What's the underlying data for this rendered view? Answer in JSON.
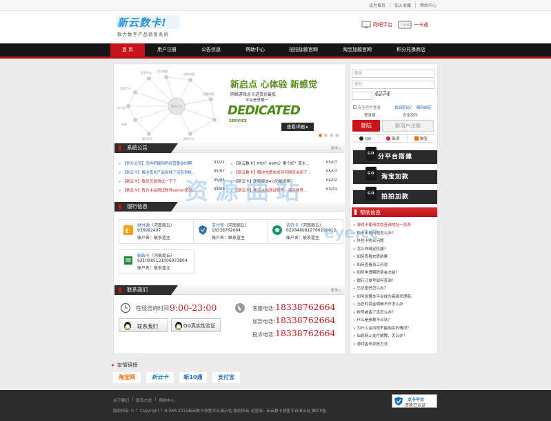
{
  "top_links": [
    "设为首页",
    "加入收藏",
    "帮助中心"
  ],
  "logo": {
    "main": "新云数卡!",
    "sub": "致力数字产品销售系统"
  },
  "header_icons": {
    "platform": "网吧平台",
    "card": "一卡通"
  },
  "nav": [
    "首 页",
    "用户注册",
    "公告信息",
    "帮助中心",
    "拍拍加款官网",
    "淘宝加款官网",
    "积分兑换商店"
  ],
  "banner": {
    "headline": "新启点 心体验 新感觉",
    "sub1": "网络游戏点卡进货价最低",
    "sub2": "平台信誉第一",
    "dedicated": "DEDICATED",
    "service": "SERVICE",
    "view": "查看详细 ▸",
    "network_labels": [
      "资源平台",
      "会员服务",
      "在线充值",
      "游戏点卡",
      "数字产品",
      "支付宝",
      "网银",
      "腾讯Q币",
      "话费充值",
      "提现平台"
    ]
  },
  "announce": {
    "title": "系统公告",
    "more": "更多»",
    "left": [
      {
        "text": "【官方交流】怎样把握网吧经营黄金时期",
        "date": "01/21",
        "color": "#2569b9"
      },
      {
        "text": "【新云卡】解决直充产品和线了没有到帐...",
        "date": "05/07",
        "color": "#2569b9"
      },
      {
        "text": "【新云卡】我仅仅是测试一下下",
        "date": "05/06",
        "color": "#c0181e"
      },
      {
        "text": "【新云卡】官方主站测试账号admin密码...",
        "date": "04/08",
        "color": "#c0181e"
      }
    ],
    "right": [
      {
        "text": "【新云数卡】PHP？ASPX？哪个好？蓝主...",
        "date": "05/07",
        "color": "#333"
      },
      {
        "text": "【新云数卡】解决充值未成功可网页关闭了...",
        "date": "05/07",
        "color": "#c0181e"
      },
      {
        "text": "【新云卡】更新版本4.0功能说明",
        "date": "04/02",
        "color": "#333"
      },
      {
        "text": "【新云卡】新云主站测试账号：演示账号...",
        "date": "03/31",
        "color": "#c0181e"
      }
    ]
  },
  "bank": {
    "title": "银行信息",
    "cards": [
      {
        "name": "财付通",
        "region": "（河南商丘）",
        "acct": "936992497",
        "owner": "账户名：联系蓝主"
      },
      {
        "name": "支付宝",
        "region": "（河南商丘）",
        "acct": "18338762664",
        "owner": "账户名：联系蓝主"
      },
      {
        "name": "农行卡",
        "region": "（河南商丘）",
        "acct": "6228480812780290912",
        "owner": "账户名：联系蓝主"
      },
      {
        "name": "邮政卡",
        "region": "（河南商丘）",
        "acct": "6210985131006973804",
        "owner": "账户名：联系蓝主"
      }
    ]
  },
  "contact": {
    "title": "联系我们",
    "more": "更多»",
    "hours_label": "在线咨询时间:",
    "hours": "9:00-23:00",
    "btn_contact": "联系我们",
    "btn_qq": "QQ真实性验证",
    "lines": [
      {
        "label": "客服电话:",
        "phone": "18338762664"
      },
      {
        "label": "加款电话:",
        "phone": "18338762664"
      },
      {
        "label": "投诉电话:",
        "phone": "18338762664"
      }
    ]
  },
  "login": {
    "user_ph": "登录",
    "pass_ph": "密码",
    "captcha": "4274",
    "remember": "安全控件登录",
    "forgot": "找回密码？",
    "unbind": "解除绑定",
    "login_sub": "登录器",
    "safe_sub": "安全控件",
    "btn_login": "登陆",
    "btn_register": "新用户注册",
    "social": [
      "QQ",
      "新浪",
      "淘宝"
    ]
  },
  "promos": [
    {
      "go": "GO",
      "text": "分平台搭建"
    },
    {
      "go": "GO",
      "text": "淘宝加款"
    },
    {
      "go": "GO",
      "text": "拍拍加款"
    }
  ],
  "help": {
    "title": "帮助信息",
    "items": [
      {
        "text": "游戏卡使用状态查询地址一览表",
        "color": "#c0181e"
      },
      {
        "text": "购卡出现问题怎么办？",
        "color": "#333"
      },
      {
        "text": "外挂卡购买问题",
        "color": "#333"
      },
      {
        "text": "怎么样绑定机器？",
        "color": "#333"
      },
      {
        "text": "如何查看充值结果",
        "color": "#333"
      },
      {
        "text": "如何查看员工利润",
        "color": "#333"
      },
      {
        "text": "如何申请解除资金冻结？",
        "color": "#333"
      },
      {
        "text": "银行订单号如何查询？",
        "color": "#333"
      },
      {
        "text": "忘记密码怎么办？",
        "color": "#333"
      },
      {
        "text": "如何加盟本平台成为高级代理商。",
        "color": "#333"
      },
      {
        "text": "当您的资金明细不齐怎么办",
        "color": "#333"
      },
      {
        "text": "帐号被盗了该怎么办？",
        "color": "#333"
      },
      {
        "text": "什么是参数不合法？",
        "color": "#333"
      },
      {
        "text": "为什么会出现不能购买的情况？",
        "color": "#333"
      },
      {
        "text": "出现网上支付故障，怎么办？",
        "color": "#333"
      },
      {
        "text": "游戏金币发放方式",
        "color": "#333"
      }
    ]
  },
  "watermark": {
    "main": "资源曲站",
    "sub": "eye.cc"
  },
  "friend_links": {
    "title": "友情链接",
    "logos": [
      "淘宝网",
      "新云卡",
      "新10通",
      "支付宝"
    ]
  },
  "footer": {
    "links": [
      "关于我们",
      "联系方式",
      "帮助中心"
    ],
    "copyright": "版权所有 © ？Copyright ？N-VAR-2011新云数卡销售平台演示站 版权所有  运营商：新云数卡销售平台演示站  豫ICP备",
    "badge1": "点卡平台",
    "badge2": "资质已认证"
  }
}
